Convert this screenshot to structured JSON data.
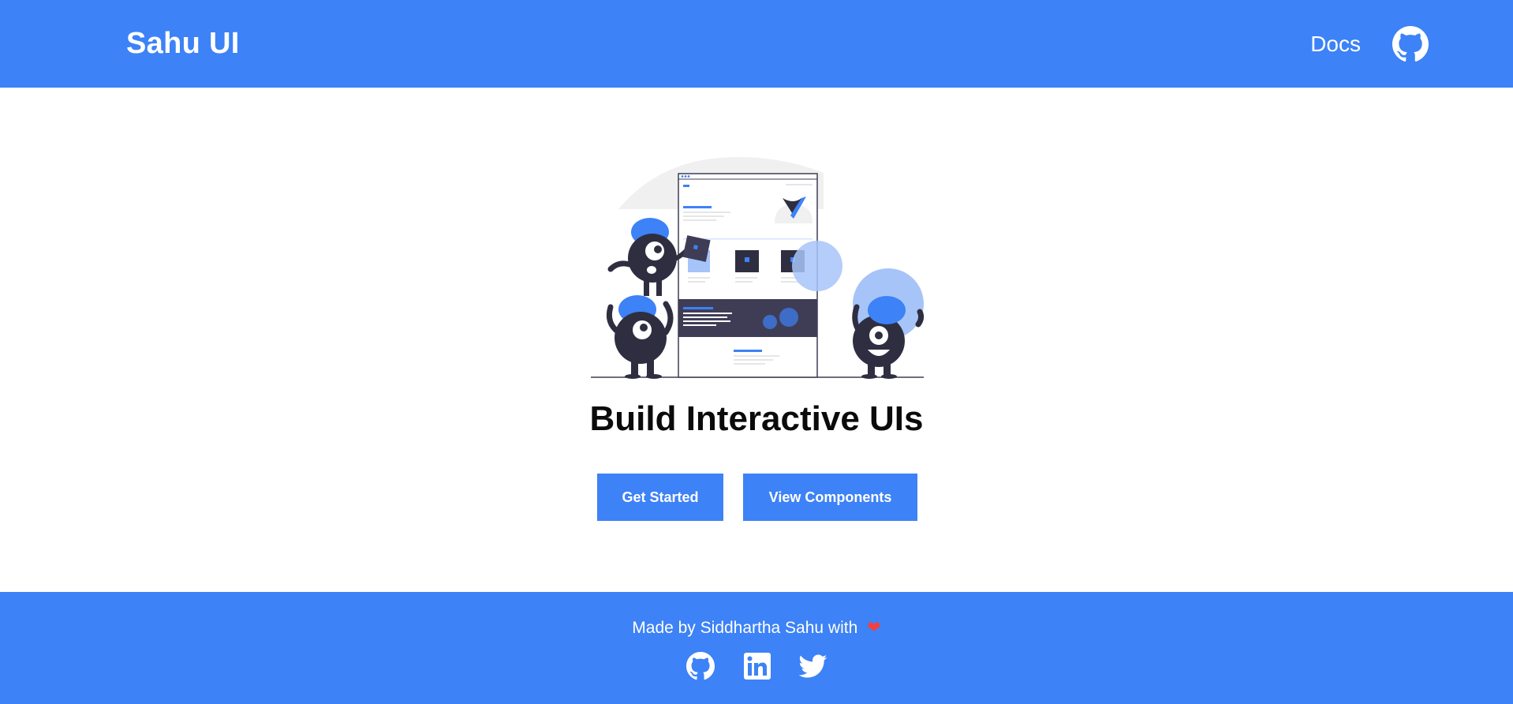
{
  "header": {
    "brand": "Sahu UI",
    "nav_docs": "Docs",
    "github_icon": "github-icon"
  },
  "hero": {
    "illustration_icon": "building-ui-illustration",
    "title": "Build Interactive UIs",
    "buttons": {
      "get_started": "Get Started",
      "view_components": "View Components"
    }
  },
  "footer": {
    "credit": "Made by Siddhartha Sahu with",
    "heart_icon": "heart-icon",
    "social": [
      {
        "icon": "github-icon"
      },
      {
        "icon": "linkedin-icon"
      },
      {
        "icon": "twitter-icon"
      }
    ]
  },
  "colors": {
    "brand_blue": "#3d82f6",
    "heart_red": "#f43f3f",
    "dark_ink": "#2f2e41",
    "light_blue": "#a7c4f9"
  }
}
